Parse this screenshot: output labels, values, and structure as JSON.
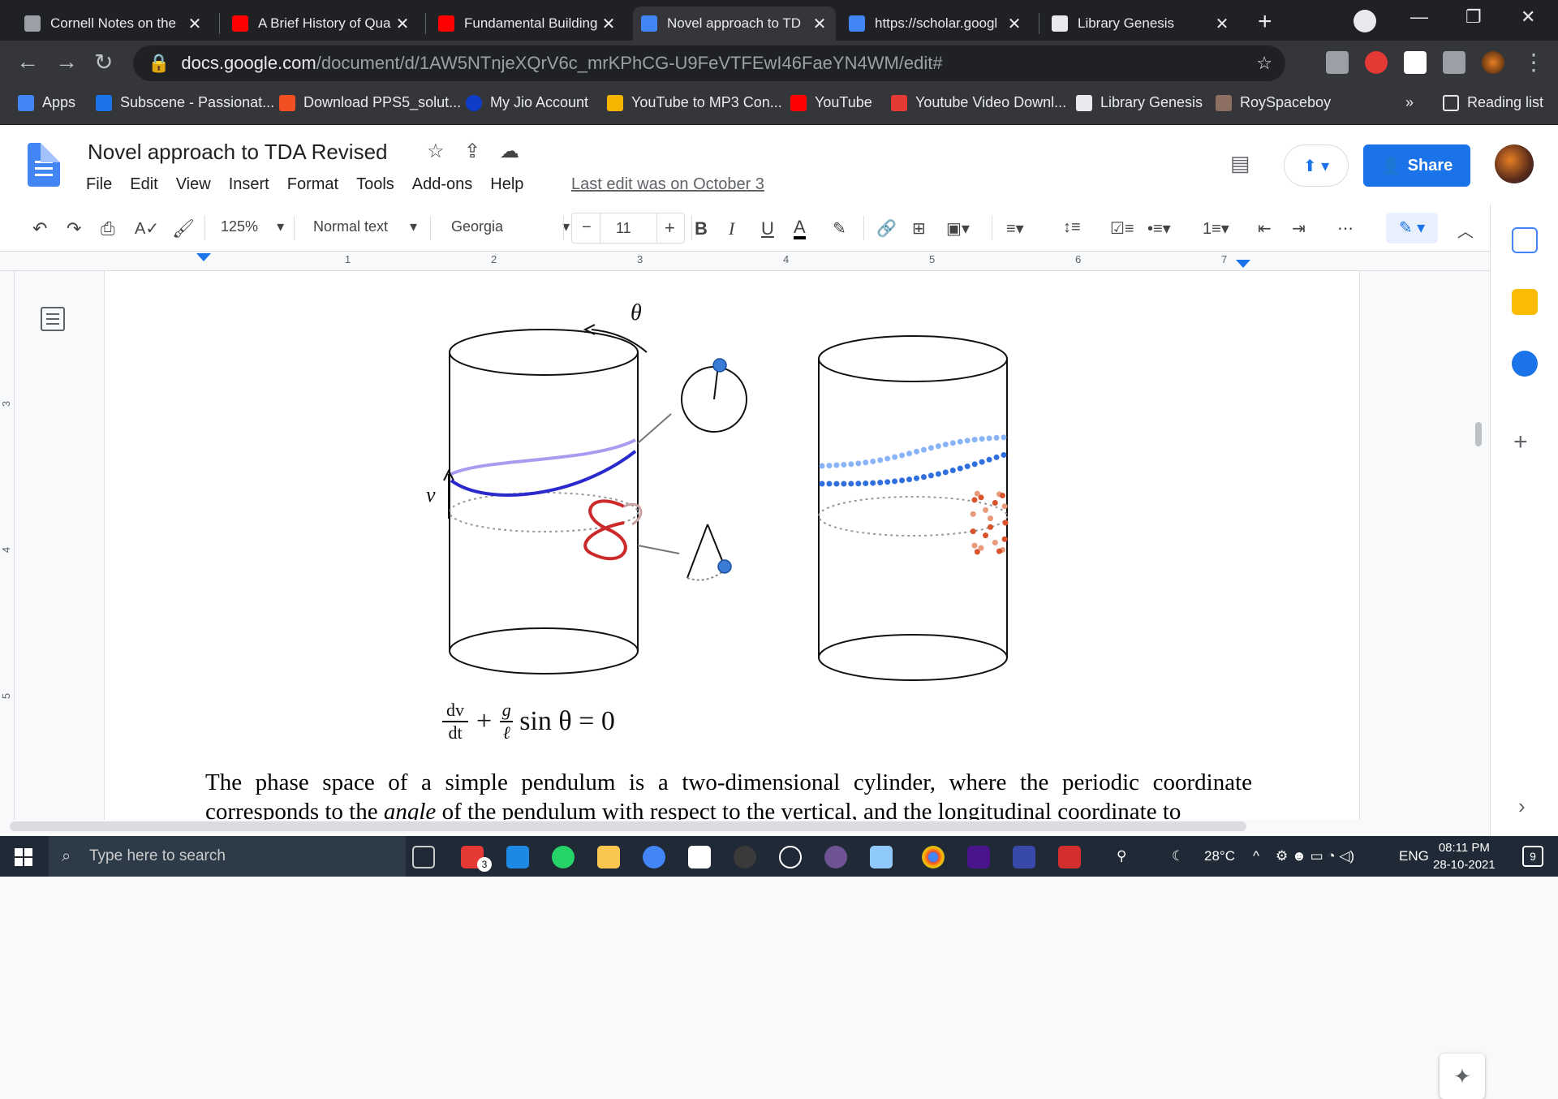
{
  "tabs": [
    {
      "title": "Cornell Notes on the",
      "favicon_color": "#9aa0a6"
    },
    {
      "title": "A Brief History of Qua",
      "favicon_color": "#ff0000"
    },
    {
      "title": "Fundamental Building",
      "favicon_color": "#ff0000"
    },
    {
      "title": "Novel approach to TD",
      "favicon_color": "#4285f4",
      "active": true
    },
    {
      "title": "https://scholar.googl",
      "favicon_color": "#4285f4"
    },
    {
      "title": "Library Genesis",
      "favicon_color": "#e8eaed"
    }
  ],
  "address": {
    "host": "docs.google.com",
    "path": "/document/d/1AW5NTnjeXQrV6c_mrKPhCG-U9FeVTFEwI46FaeYN4WM/edit#"
  },
  "bookmarks": [
    {
      "label": "Apps",
      "color": "#4285f4"
    },
    {
      "label": "Subscene - Passionat...",
      "color": "#1a73e8"
    },
    {
      "label": "Download PPS5_solut...",
      "color": "#f25022"
    },
    {
      "label": "My Jio Account",
      "color": "#0f3cc9"
    },
    {
      "label": "YouTube to MP3 Con...",
      "color": "#f4b400"
    },
    {
      "label": "YouTube",
      "color": "#ff0000"
    },
    {
      "label": "Youtube Video Downl...",
      "color": "#e53935"
    },
    {
      "label": "Library Genesis",
      "color": "#e8eaed"
    },
    {
      "label": "RoySpaceboy",
      "color": "#8d6e63"
    }
  ],
  "bookmarks_more": "»",
  "reading_list": "Reading list",
  "doc": {
    "title": "Novel approach to TDA Revised",
    "menu": [
      "File",
      "Edit",
      "View",
      "Insert",
      "Format",
      "Tools",
      "Add-ons",
      "Help"
    ],
    "last_edit": "Last edit was on October 3",
    "share_label": "Share"
  },
  "format_toolbar": {
    "zoom": "125%",
    "style": "Normal text",
    "font": "Georgia",
    "font_size": "11"
  },
  "ruler_numbers": [
    "1",
    "2",
    "3",
    "4",
    "5",
    "6",
    "7"
  ],
  "vruler_numbers": [
    "3",
    "4",
    "5"
  ],
  "figure": {
    "theta_label": "θ",
    "v_label": "v",
    "equation": {
      "frac_num": "dv",
      "frac_den": "dt",
      "plus": "+",
      "g": "g",
      "ell": "ℓ",
      "rest": "sin θ = 0"
    }
  },
  "body_line1": "The phase space of a simple pendulum is a two-dimensional cylinder, where the periodic coordinate",
  "body_line2_pre": "corresponds to the ",
  "body_line2_em": "angle",
  "body_line2_post": " of the pendulum with respect to the vertical, and the longitudinal coordinate to",
  "taskbar": {
    "search_placeholder": "Type here to search",
    "weather": "28°C",
    "language": "ENG",
    "time": "08:11 PM",
    "date": "28-10-2021",
    "notifications": "9",
    "badge": "3"
  }
}
